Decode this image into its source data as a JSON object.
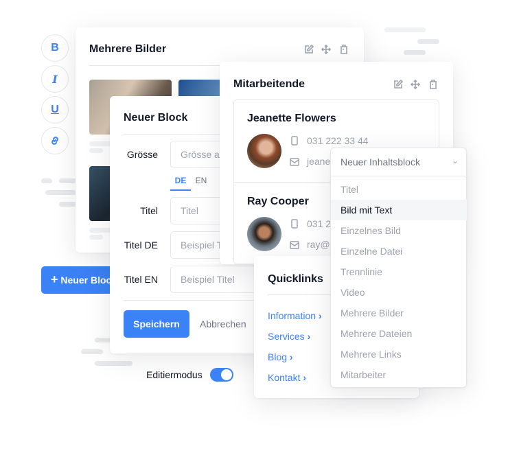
{
  "format_toolbar": {
    "bold": "B",
    "italic": "I",
    "underline": "U",
    "link_icon": "link-icon"
  },
  "new_block_button": {
    "label": "Neuer Block",
    "icon": "plus-icon"
  },
  "images_card": {
    "title": "Mehrere Bilder",
    "actions": [
      "edit-icon",
      "move-icon",
      "trash-icon"
    ]
  },
  "new_block_form": {
    "title": "Neuer Block",
    "size_label": "Grösse",
    "size_placeholder": "Grösse auswählen",
    "lang_tabs": [
      {
        "label": "DE",
        "active": true
      },
      {
        "label": "EN",
        "active": false
      }
    ],
    "title_label": "Titel",
    "title_placeholder": "Titel",
    "title_de_label": "Titel DE",
    "title_de_placeholder": "Beispiel Titel",
    "title_en_label": "Titel EN",
    "title_en_placeholder": "Beispiel Titel",
    "save": "Speichern",
    "cancel": "Abbrechen"
  },
  "edit_mode": {
    "label": "Editiermodus",
    "enabled": true
  },
  "employees_card": {
    "title": "Mitarbeitende",
    "actions": [
      "edit-icon",
      "move-icon",
      "trash-icon"
    ],
    "people": [
      {
        "name": "Jeanette Flowers",
        "phone": "031 222 33 44",
        "email": "jeanette@"
      },
      {
        "name": "Ray Cooper",
        "phone": "031 2",
        "email": "ray@"
      }
    ]
  },
  "quicklinks": {
    "title": "Quicklinks",
    "links": [
      "Information",
      "Services",
      "Blog",
      "Kontakt"
    ]
  },
  "content_dropdown": {
    "placeholder": "Neuer Inhaltsblock",
    "highlighted": "Bild mit Text",
    "options": [
      "Titel",
      "Bild mit Text",
      "Einzelnes Bild",
      "Einzelne Datei",
      "Trennlinie",
      "Video",
      "Mehrere Bilder",
      "Mehrere Dateien",
      "Mehrere Links",
      "Mitarbeiter"
    ]
  },
  "colors": {
    "accent": "#3b82f6",
    "text": "#111827",
    "muted": "#9ca3af"
  }
}
